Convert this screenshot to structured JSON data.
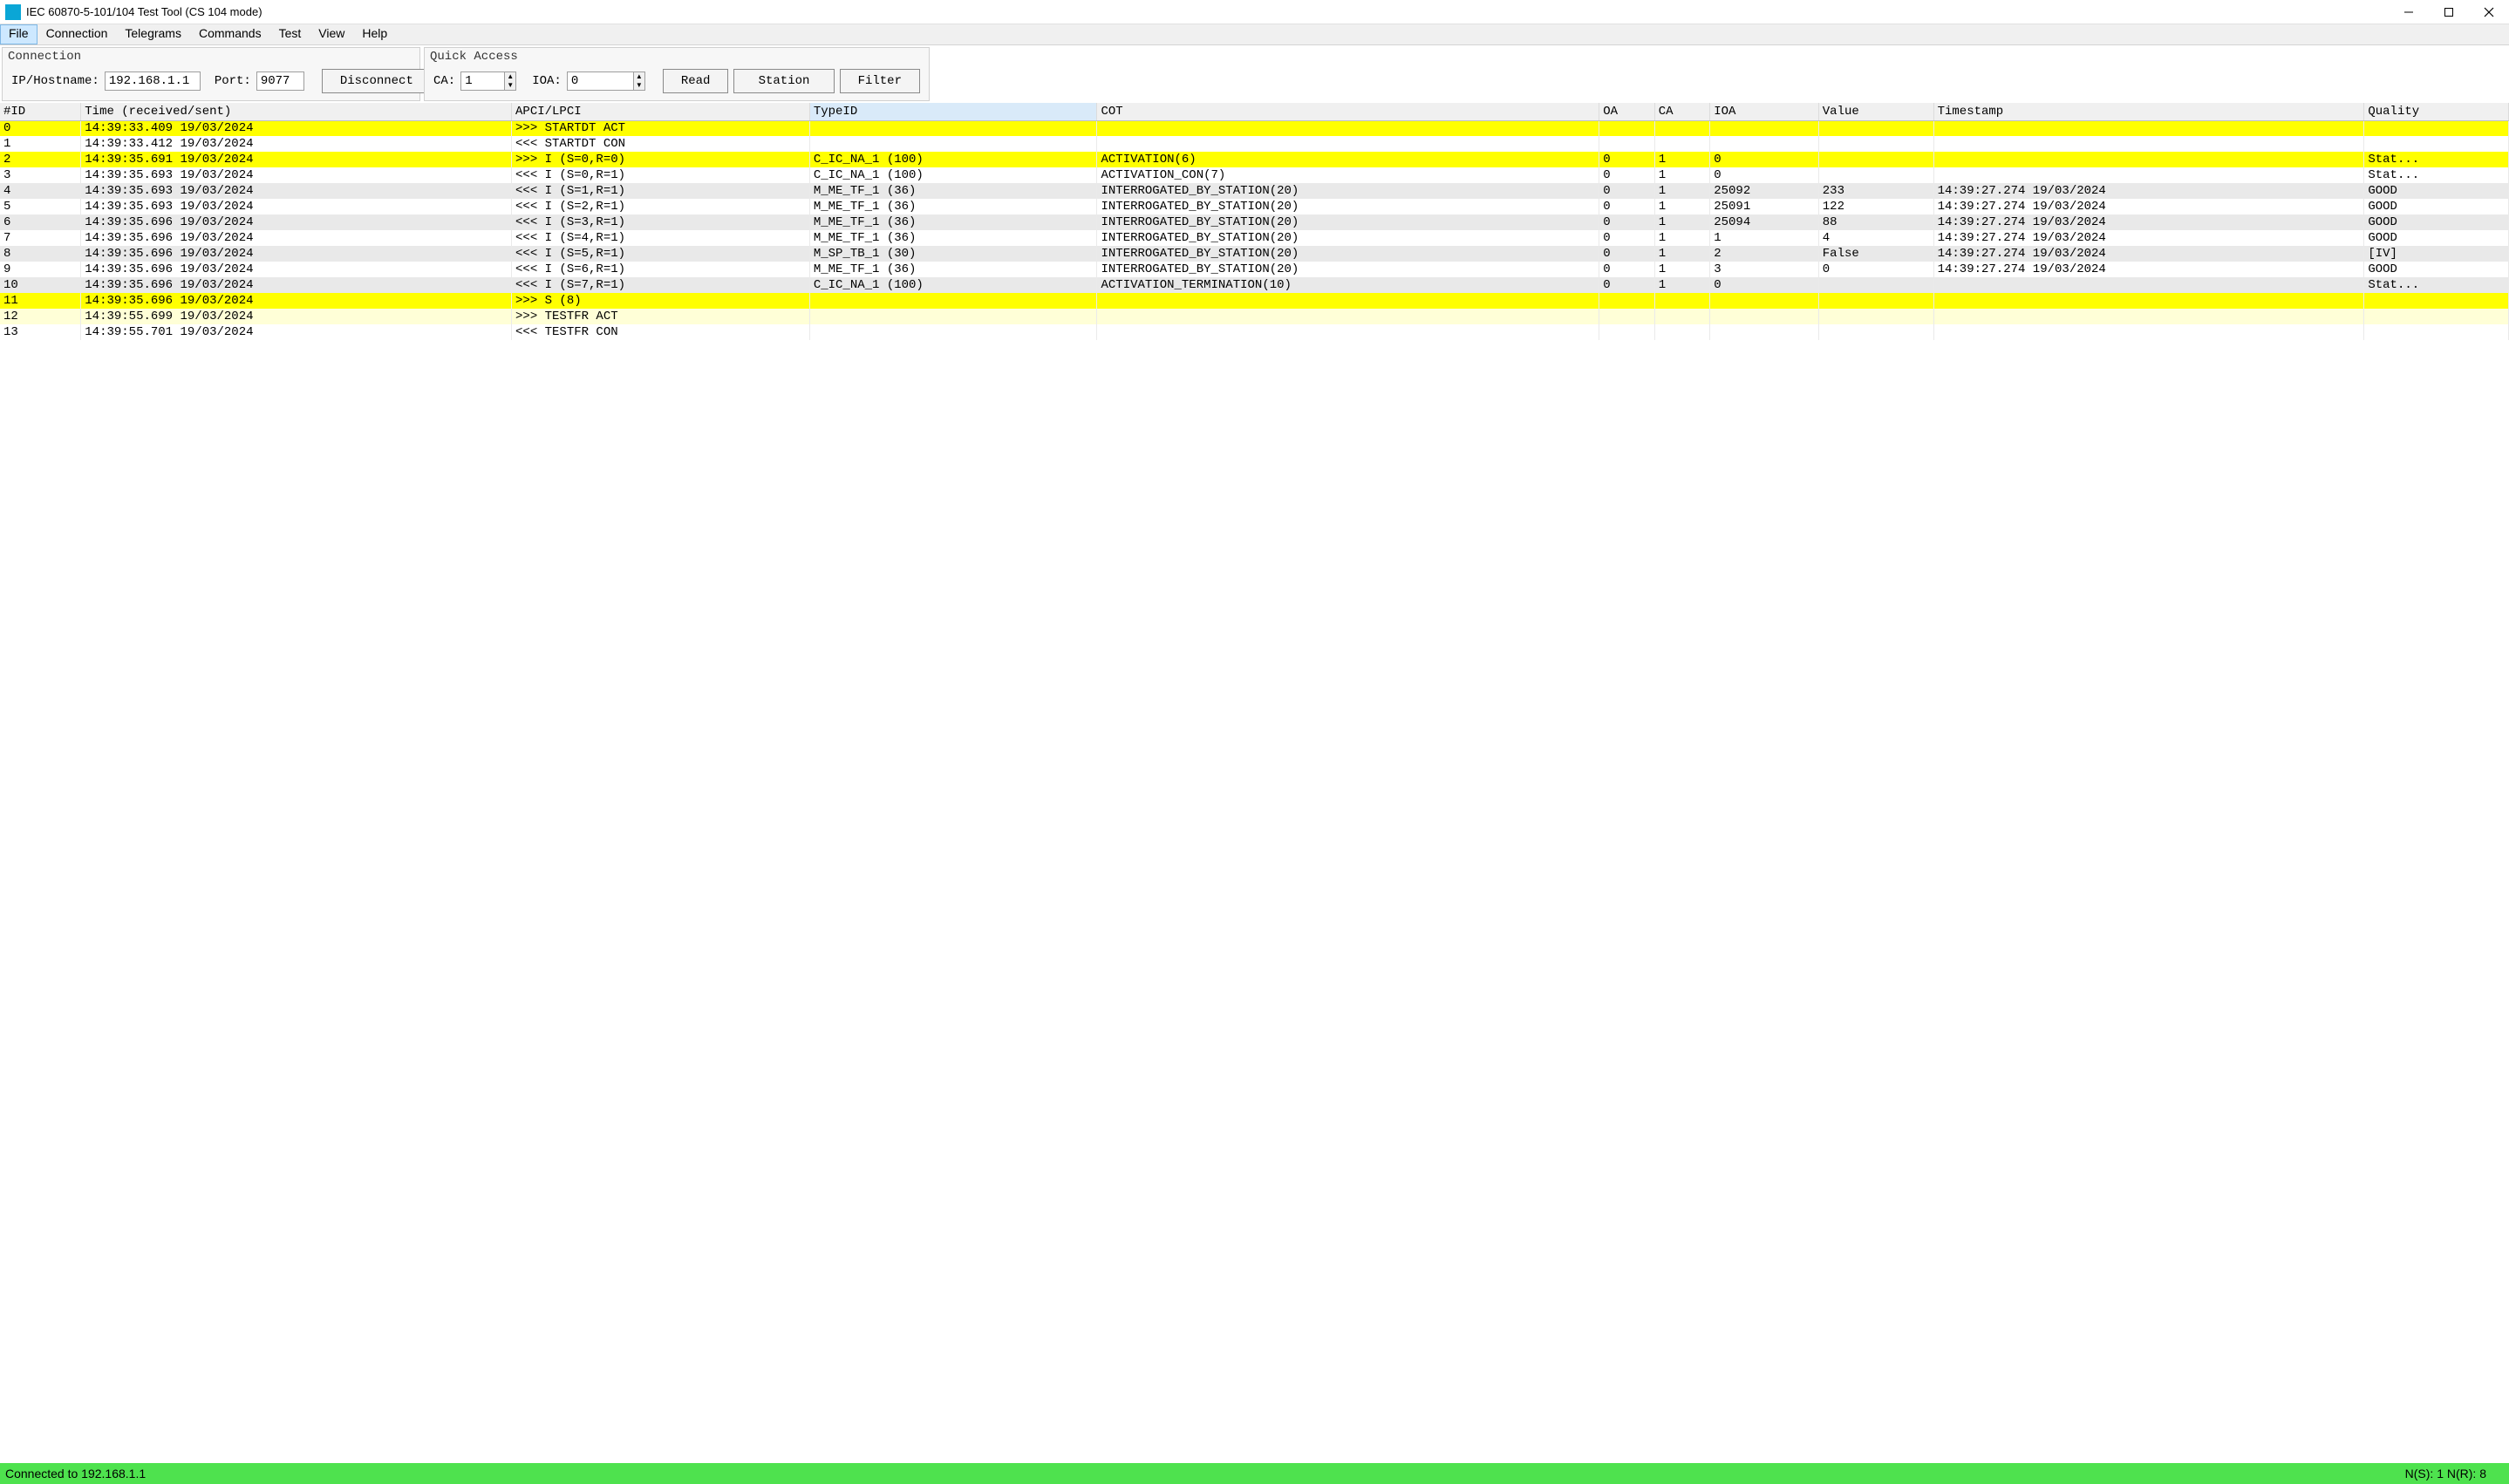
{
  "title": "IEC 60870-5-101/104 Test Tool (CS 104 mode)",
  "menu": [
    "File",
    "Connection",
    "Telegrams",
    "Commands",
    "Test",
    "View",
    "Help"
  ],
  "menu_selected_index": 0,
  "conn": {
    "group": "Connection",
    "ip_label": "IP/Hostname:",
    "ip": "192.168.1.1",
    "port_label": "Port:",
    "port": "9077",
    "disconnect": "Disconnect"
  },
  "qa": {
    "group": "Quick Access",
    "ca_label": "CA:",
    "ca": "1",
    "ioa_label": "IOA:",
    "ioa": "0",
    "read": "Read",
    "station": "Station",
    "filter": "Filter"
  },
  "cols": [
    "#ID",
    "Time (received/sent)",
    "APCI/LPCI",
    "TypeID",
    "COT",
    "OA",
    "CA",
    "IOA",
    "Value",
    "Timestamp",
    "Quality"
  ],
  "sort_col_index": 3,
  "rows": [
    {
      "cls": "row-yel",
      "cells": [
        "0",
        "14:39:33.409 19/03/2024",
        ">>> STARTDT ACT",
        "",
        "",
        "",
        "",
        "",
        "",
        "",
        ""
      ]
    },
    {
      "cls": "row-norm",
      "cells": [
        "1",
        "14:39:33.412 19/03/2024",
        "<<< STARTDT CON",
        "",
        "",
        "",
        "",
        "",
        "",
        "",
        ""
      ]
    },
    {
      "cls": "row-yel",
      "cells": [
        "2",
        "14:39:35.691 19/03/2024",
        ">>> I (S=0,R=0)",
        "C_IC_NA_1 (100)",
        "ACTIVATION(6)",
        "0",
        "1",
        "0",
        "",
        "",
        "Stat..."
      ]
    },
    {
      "cls": "row-norm",
      "cells": [
        "3",
        "14:39:35.693 19/03/2024",
        "<<< I (S=0,R=1)",
        "C_IC_NA_1 (100)",
        "ACTIVATION_CON(7)",
        "0",
        "1",
        "0",
        "",
        "",
        "Stat..."
      ]
    },
    {
      "cls": "row-alt",
      "cells": [
        "4",
        "14:39:35.693 19/03/2024",
        "<<< I (S=1,R=1)",
        "M_ME_TF_1 (36)",
        "INTERROGATED_BY_STATION(20)",
        "0",
        "1",
        "25092",
        "233",
        "14:39:27.274 19/03/2024",
        "GOOD"
      ]
    },
    {
      "cls": "row-norm",
      "cells": [
        "5",
        "14:39:35.693 19/03/2024",
        "<<< I (S=2,R=1)",
        "M_ME_TF_1 (36)",
        "INTERROGATED_BY_STATION(20)",
        "0",
        "1",
        "25091",
        "122",
        "14:39:27.274 19/03/2024",
        "GOOD"
      ]
    },
    {
      "cls": "row-alt",
      "cells": [
        "6",
        "14:39:35.696 19/03/2024",
        "<<< I (S=3,R=1)",
        "M_ME_TF_1 (36)",
        "INTERROGATED_BY_STATION(20)",
        "0",
        "1",
        "25094",
        "88",
        "14:39:27.274 19/03/2024",
        "GOOD"
      ]
    },
    {
      "cls": "row-norm",
      "cells": [
        "7",
        "14:39:35.696 19/03/2024",
        "<<< I (S=4,R=1)",
        "M_ME_TF_1 (36)",
        "INTERROGATED_BY_STATION(20)",
        "0",
        "1",
        "1",
        "4",
        "14:39:27.274 19/03/2024",
        "GOOD"
      ]
    },
    {
      "cls": "row-alt",
      "cells": [
        "8",
        "14:39:35.696 19/03/2024",
        "<<< I (S=5,R=1)",
        "M_SP_TB_1 (30)",
        "INTERROGATED_BY_STATION(20)",
        "0",
        "1",
        "2",
        "False",
        "14:39:27.274 19/03/2024",
        "[IV]"
      ]
    },
    {
      "cls": "row-norm",
      "cells": [
        "9",
        "14:39:35.696 19/03/2024",
        "<<< I (S=6,R=1)",
        "M_ME_TF_1 (36)",
        "INTERROGATED_BY_STATION(20)",
        "0",
        "1",
        "3",
        "0",
        "14:39:27.274 19/03/2024",
        "GOOD"
      ]
    },
    {
      "cls": "row-alt",
      "cells": [
        "10",
        "14:39:35.696 19/03/2024",
        "<<< I (S=7,R=1)",
        "C_IC_NA_1 (100)",
        "ACTIVATION_TERMINATION(10)",
        "0",
        "1",
        "0",
        "",
        "",
        "Stat..."
      ]
    },
    {
      "cls": "row-yel",
      "cells": [
        "11",
        "14:39:35.696 19/03/2024",
        ">>> S (8)",
        "",
        "",
        "",
        "",
        "",
        "",
        "",
        ""
      ]
    },
    {
      "cls": "row-lty",
      "cells": [
        "12",
        "14:39:55.699 19/03/2024",
        ">>> TESTFR ACT",
        "",
        "",
        "",
        "",
        "",
        "",
        "",
        ""
      ]
    },
    {
      "cls": "row-norm",
      "cells": [
        "13",
        "14:39:55.701 19/03/2024",
        "<<< TESTFR CON",
        "",
        "",
        "",
        "",
        "",
        "",
        "",
        ""
      ]
    }
  ],
  "status": {
    "left": "Connected to 192.168.1.1",
    "right": "N(S):  1  N(R):  8"
  }
}
